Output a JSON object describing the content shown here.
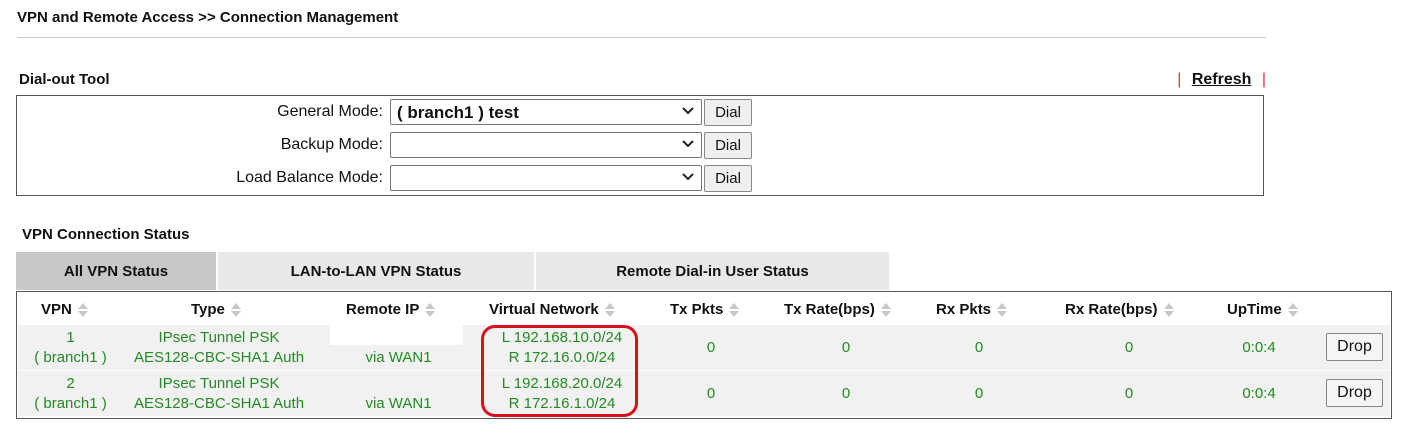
{
  "header": {
    "title": "VPN and Remote Access >> Connection Management"
  },
  "dialout": {
    "title": "Dial-out Tool",
    "refresh_label": "Refresh",
    "pipe": "|",
    "modes": [
      {
        "label": "General Mode:",
        "value": "( branch1 ) test",
        "button": "Dial"
      },
      {
        "label": "Backup Mode:",
        "value": "",
        "button": "Dial"
      },
      {
        "label": "Load Balance Mode:",
        "value": "",
        "button": "Dial"
      }
    ]
  },
  "status": {
    "title": "VPN Connection Status",
    "tabs": [
      "All VPN Status",
      "LAN-to-LAN VPN Status",
      "Remote Dial-in User Status"
    ],
    "columns": [
      "VPN",
      "Type",
      "Remote IP",
      "Virtual Network",
      "Tx Pkts",
      "Tx Rate(bps)",
      "Rx Pkts",
      "Rx Rate(bps)",
      "UpTime"
    ],
    "rows": [
      {
        "vpn_no": "1",
        "vpn_name": "( branch1 )",
        "type1": "IPsec Tunnel PSK",
        "type2": "AES128-CBC-SHA1 Auth",
        "remote_ip": "via WAN1",
        "vnet_local": "L 192.168.10.0/24",
        "vnet_remote": "R 172.16.0.0/24",
        "tx_pkts": "0",
        "tx_rate": "0",
        "rx_pkts": "0",
        "rx_rate": "0",
        "uptime": "0:0:4",
        "action": "Drop"
      },
      {
        "vpn_no": "2",
        "vpn_name": "( branch1 )",
        "type1": "IPsec Tunnel PSK",
        "type2": "AES128-CBC-SHA1 Auth",
        "remote_ip": "via WAN1",
        "vnet_local": "L 192.168.20.0/24",
        "vnet_remote": "R 172.16.1.0/24",
        "tx_pkts": "0",
        "tx_rate": "0",
        "rx_pkts": "0",
        "rx_rate": "0",
        "uptime": "0:0:4",
        "action": "Drop"
      }
    ]
  },
  "colors": {
    "green_text": "#228b22",
    "highlight": "#d8101c",
    "pipe": "#e03030"
  }
}
